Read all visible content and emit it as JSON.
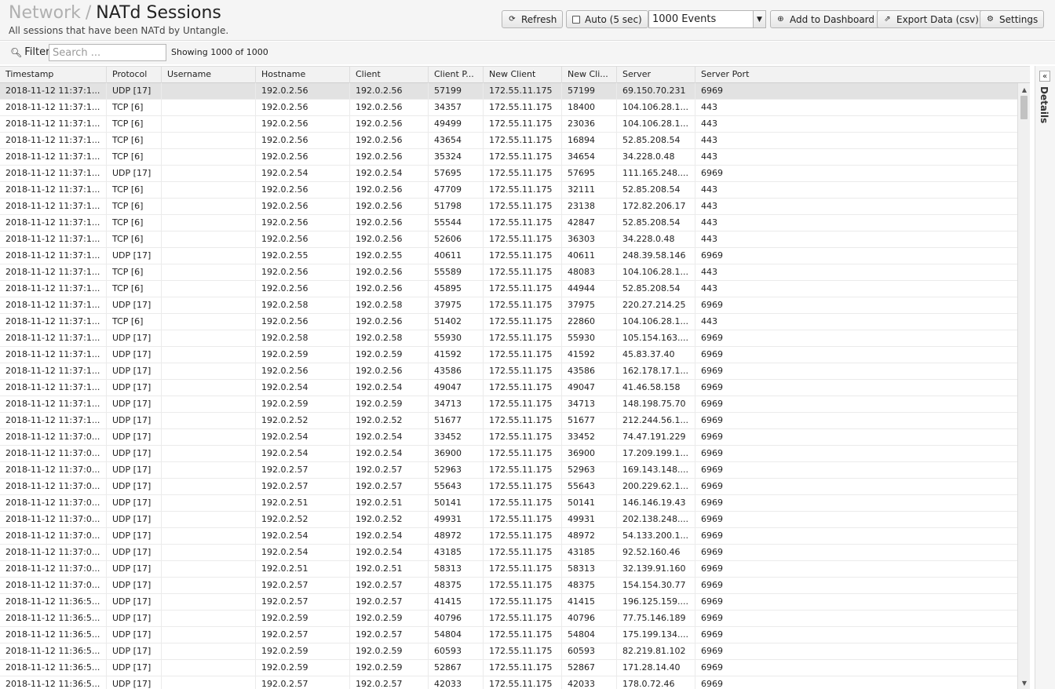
{
  "header": {
    "breadcrumb_root": "Network",
    "separator": "/",
    "title": "NATd Sessions",
    "subtitle": "All sessions that have been NATd by Untangle."
  },
  "toolbar": {
    "refresh": "Refresh",
    "auto": "Auto (5 sec)",
    "events_select": "1000 Events",
    "add_dashboard": "Add to Dashboard",
    "export": "Export Data (csv)",
    "settings": "Settings"
  },
  "filter": {
    "label": "Filter",
    "placeholder": "Search ...",
    "showing": "Showing 1000 of 1000"
  },
  "details_panel": {
    "label": "Details"
  },
  "columns": [
    "Timestamp",
    "Protocol",
    "Username",
    "Hostname",
    "Client",
    "Client P...",
    "New Client",
    "New Cli...",
    "Server",
    "Server Port"
  ],
  "rows": [
    [
      "2018-11-12 11:37:1...",
      "UDP [17]",
      "",
      "192.0.2.56",
      "192.0.2.56",
      "57199",
      "172.55.11.175",
      "57199",
      "69.150.70.231",
      "6969"
    ],
    [
      "2018-11-12 11:37:1...",
      "TCP [6]",
      "",
      "192.0.2.56",
      "192.0.2.56",
      "34357",
      "172.55.11.175",
      "18400",
      "104.106.28.1...",
      "443"
    ],
    [
      "2018-11-12 11:37:1...",
      "TCP [6]",
      "",
      "192.0.2.56",
      "192.0.2.56",
      "49499",
      "172.55.11.175",
      "23036",
      "104.106.28.1...",
      "443"
    ],
    [
      "2018-11-12 11:37:1...",
      "TCP [6]",
      "",
      "192.0.2.56",
      "192.0.2.56",
      "43654",
      "172.55.11.175",
      "16894",
      "52.85.208.54",
      "443"
    ],
    [
      "2018-11-12 11:37:1...",
      "TCP [6]",
      "",
      "192.0.2.56",
      "192.0.2.56",
      "35324",
      "172.55.11.175",
      "34654",
      "34.228.0.48",
      "443"
    ],
    [
      "2018-11-12 11:37:1...",
      "UDP [17]",
      "",
      "192.0.2.54",
      "192.0.2.54",
      "57695",
      "172.55.11.175",
      "57695",
      "111.165.248....",
      "6969"
    ],
    [
      "2018-11-12 11:37:1...",
      "TCP [6]",
      "",
      "192.0.2.56",
      "192.0.2.56",
      "47709",
      "172.55.11.175",
      "32111",
      "52.85.208.54",
      "443"
    ],
    [
      "2018-11-12 11:37:1...",
      "TCP [6]",
      "",
      "192.0.2.56",
      "192.0.2.56",
      "51798",
      "172.55.11.175",
      "23138",
      "172.82.206.17",
      "443"
    ],
    [
      "2018-11-12 11:37:1...",
      "TCP [6]",
      "",
      "192.0.2.56",
      "192.0.2.56",
      "55544",
      "172.55.11.175",
      "42847",
      "52.85.208.54",
      "443"
    ],
    [
      "2018-11-12 11:37:1...",
      "TCP [6]",
      "",
      "192.0.2.56",
      "192.0.2.56",
      "52606",
      "172.55.11.175",
      "36303",
      "34.228.0.48",
      "443"
    ],
    [
      "2018-11-12 11:37:1...",
      "UDP [17]",
      "",
      "192.0.2.55",
      "192.0.2.55",
      "40611",
      "172.55.11.175",
      "40611",
      "248.39.58.146",
      "6969"
    ],
    [
      "2018-11-12 11:37:1...",
      "TCP [6]",
      "",
      "192.0.2.56",
      "192.0.2.56",
      "55589",
      "172.55.11.175",
      "48083",
      "104.106.28.1...",
      "443"
    ],
    [
      "2018-11-12 11:37:1...",
      "TCP [6]",
      "",
      "192.0.2.56",
      "192.0.2.56",
      "45895",
      "172.55.11.175",
      "44944",
      "52.85.208.54",
      "443"
    ],
    [
      "2018-11-12 11:37:1...",
      "UDP [17]",
      "",
      "192.0.2.58",
      "192.0.2.58",
      "37975",
      "172.55.11.175",
      "37975",
      "220.27.214.25",
      "6969"
    ],
    [
      "2018-11-12 11:37:1...",
      "TCP [6]",
      "",
      "192.0.2.56",
      "192.0.2.56",
      "51402",
      "172.55.11.175",
      "22860",
      "104.106.28.1...",
      "443"
    ],
    [
      "2018-11-12 11:37:1...",
      "UDP [17]",
      "",
      "192.0.2.58",
      "192.0.2.58",
      "55930",
      "172.55.11.175",
      "55930",
      "105.154.163....",
      "6969"
    ],
    [
      "2018-11-12 11:37:1...",
      "UDP [17]",
      "",
      "192.0.2.59",
      "192.0.2.59",
      "41592",
      "172.55.11.175",
      "41592",
      "45.83.37.40",
      "6969"
    ],
    [
      "2018-11-12 11:37:1...",
      "UDP [17]",
      "",
      "192.0.2.56",
      "192.0.2.56",
      "43586",
      "172.55.11.175",
      "43586",
      "162.178.17.1...",
      "6969"
    ],
    [
      "2018-11-12 11:37:1...",
      "UDP [17]",
      "",
      "192.0.2.54",
      "192.0.2.54",
      "49047",
      "172.55.11.175",
      "49047",
      "41.46.58.158",
      "6969"
    ],
    [
      "2018-11-12 11:37:1...",
      "UDP [17]",
      "",
      "192.0.2.59",
      "192.0.2.59",
      "34713",
      "172.55.11.175",
      "34713",
      "148.198.75.70",
      "6969"
    ],
    [
      "2018-11-12 11:37:1...",
      "UDP [17]",
      "",
      "192.0.2.52",
      "192.0.2.52",
      "51677",
      "172.55.11.175",
      "51677",
      "212.244.56.1...",
      "6969"
    ],
    [
      "2018-11-12 11:37:0...",
      "UDP [17]",
      "",
      "192.0.2.54",
      "192.0.2.54",
      "33452",
      "172.55.11.175",
      "33452",
      "74.47.191.229",
      "6969"
    ],
    [
      "2018-11-12 11:37:0...",
      "UDP [17]",
      "",
      "192.0.2.54",
      "192.0.2.54",
      "36900",
      "172.55.11.175",
      "36900",
      "17.209.199.1...",
      "6969"
    ],
    [
      "2018-11-12 11:37:0...",
      "UDP [17]",
      "",
      "192.0.2.57",
      "192.0.2.57",
      "52963",
      "172.55.11.175",
      "52963",
      "169.143.148....",
      "6969"
    ],
    [
      "2018-11-12 11:37:0...",
      "UDP [17]",
      "",
      "192.0.2.57",
      "192.0.2.57",
      "55643",
      "172.55.11.175",
      "55643",
      "200.229.62.1...",
      "6969"
    ],
    [
      "2018-11-12 11:37:0...",
      "UDP [17]",
      "",
      "192.0.2.51",
      "192.0.2.51",
      "50141",
      "172.55.11.175",
      "50141",
      "146.146.19.43",
      "6969"
    ],
    [
      "2018-11-12 11:37:0...",
      "UDP [17]",
      "",
      "192.0.2.52",
      "192.0.2.52",
      "49931",
      "172.55.11.175",
      "49931",
      "202.138.248....",
      "6969"
    ],
    [
      "2018-11-12 11:37:0...",
      "UDP [17]",
      "",
      "192.0.2.54",
      "192.0.2.54",
      "48972",
      "172.55.11.175",
      "48972",
      "54.133.200.1...",
      "6969"
    ],
    [
      "2018-11-12 11:37:0...",
      "UDP [17]",
      "",
      "192.0.2.54",
      "192.0.2.54",
      "43185",
      "172.55.11.175",
      "43185",
      "92.52.160.46",
      "6969"
    ],
    [
      "2018-11-12 11:37:0...",
      "UDP [17]",
      "",
      "192.0.2.51",
      "192.0.2.51",
      "58313",
      "172.55.11.175",
      "58313",
      "32.139.91.160",
      "6969"
    ],
    [
      "2018-11-12 11:37:0...",
      "UDP [17]",
      "",
      "192.0.2.57",
      "192.0.2.57",
      "48375",
      "172.55.11.175",
      "48375",
      "154.154.30.77",
      "6969"
    ],
    [
      "2018-11-12 11:36:5...",
      "UDP [17]",
      "",
      "192.0.2.57",
      "192.0.2.57",
      "41415",
      "172.55.11.175",
      "41415",
      "196.125.159....",
      "6969"
    ],
    [
      "2018-11-12 11:36:5...",
      "UDP [17]",
      "",
      "192.0.2.59",
      "192.0.2.59",
      "40796",
      "172.55.11.175",
      "40796",
      "77.75.146.189",
      "6969"
    ],
    [
      "2018-11-12 11:36:5...",
      "UDP [17]",
      "",
      "192.0.2.57",
      "192.0.2.57",
      "54804",
      "172.55.11.175",
      "54804",
      "175.199.134....",
      "6969"
    ],
    [
      "2018-11-12 11:36:5...",
      "UDP [17]",
      "",
      "192.0.2.59",
      "192.0.2.59",
      "60593",
      "172.55.11.175",
      "60593",
      "82.219.81.102",
      "6969"
    ],
    [
      "2018-11-12 11:36:5...",
      "UDP [17]",
      "",
      "192.0.2.59",
      "192.0.2.59",
      "52867",
      "172.55.11.175",
      "52867",
      "171.28.14.40",
      "6969"
    ],
    [
      "2018-11-12 11:36:5...",
      "UDP [17]",
      "",
      "192.0.2.57",
      "192.0.2.57",
      "42033",
      "172.55.11.175",
      "42033",
      "178.0.72.46",
      "6969"
    ]
  ]
}
